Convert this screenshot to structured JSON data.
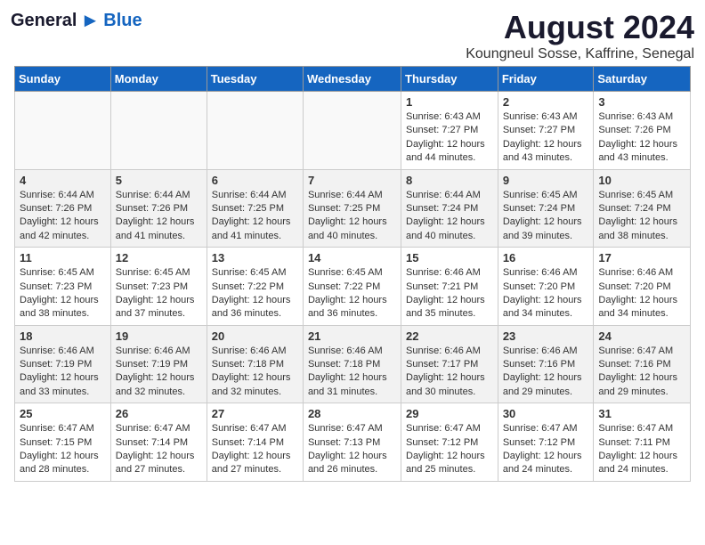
{
  "header": {
    "logo": {
      "general": "General",
      "blue": "Blue"
    },
    "title": "August 2024",
    "location": "Koungneul Sosse, Kaffrine, Senegal"
  },
  "calendar": {
    "days_of_week": [
      "Sunday",
      "Monday",
      "Tuesday",
      "Wednesday",
      "Thursday",
      "Friday",
      "Saturday"
    ],
    "weeks": [
      [
        {
          "day": "",
          "info": ""
        },
        {
          "day": "",
          "info": ""
        },
        {
          "day": "",
          "info": ""
        },
        {
          "day": "",
          "info": ""
        },
        {
          "day": "1",
          "info": "Sunrise: 6:43 AM\nSunset: 7:27 PM\nDaylight: 12 hours\nand 44 minutes."
        },
        {
          "day": "2",
          "info": "Sunrise: 6:43 AM\nSunset: 7:27 PM\nDaylight: 12 hours\nand 43 minutes."
        },
        {
          "day": "3",
          "info": "Sunrise: 6:43 AM\nSunset: 7:26 PM\nDaylight: 12 hours\nand 43 minutes."
        }
      ],
      [
        {
          "day": "4",
          "info": "Sunrise: 6:44 AM\nSunset: 7:26 PM\nDaylight: 12 hours\nand 42 minutes."
        },
        {
          "day": "5",
          "info": "Sunrise: 6:44 AM\nSunset: 7:26 PM\nDaylight: 12 hours\nand 41 minutes."
        },
        {
          "day": "6",
          "info": "Sunrise: 6:44 AM\nSunset: 7:25 PM\nDaylight: 12 hours\nand 41 minutes."
        },
        {
          "day": "7",
          "info": "Sunrise: 6:44 AM\nSunset: 7:25 PM\nDaylight: 12 hours\nand 40 minutes."
        },
        {
          "day": "8",
          "info": "Sunrise: 6:44 AM\nSunset: 7:24 PM\nDaylight: 12 hours\nand 40 minutes."
        },
        {
          "day": "9",
          "info": "Sunrise: 6:45 AM\nSunset: 7:24 PM\nDaylight: 12 hours\nand 39 minutes."
        },
        {
          "day": "10",
          "info": "Sunrise: 6:45 AM\nSunset: 7:24 PM\nDaylight: 12 hours\nand 38 minutes."
        }
      ],
      [
        {
          "day": "11",
          "info": "Sunrise: 6:45 AM\nSunset: 7:23 PM\nDaylight: 12 hours\nand 38 minutes."
        },
        {
          "day": "12",
          "info": "Sunrise: 6:45 AM\nSunset: 7:23 PM\nDaylight: 12 hours\nand 37 minutes."
        },
        {
          "day": "13",
          "info": "Sunrise: 6:45 AM\nSunset: 7:22 PM\nDaylight: 12 hours\nand 36 minutes."
        },
        {
          "day": "14",
          "info": "Sunrise: 6:45 AM\nSunset: 7:22 PM\nDaylight: 12 hours\nand 36 minutes."
        },
        {
          "day": "15",
          "info": "Sunrise: 6:46 AM\nSunset: 7:21 PM\nDaylight: 12 hours\nand 35 minutes."
        },
        {
          "day": "16",
          "info": "Sunrise: 6:46 AM\nSunset: 7:20 PM\nDaylight: 12 hours\nand 34 minutes."
        },
        {
          "day": "17",
          "info": "Sunrise: 6:46 AM\nSunset: 7:20 PM\nDaylight: 12 hours\nand 34 minutes."
        }
      ],
      [
        {
          "day": "18",
          "info": "Sunrise: 6:46 AM\nSunset: 7:19 PM\nDaylight: 12 hours\nand 33 minutes."
        },
        {
          "day": "19",
          "info": "Sunrise: 6:46 AM\nSunset: 7:19 PM\nDaylight: 12 hours\nand 32 minutes."
        },
        {
          "day": "20",
          "info": "Sunrise: 6:46 AM\nSunset: 7:18 PM\nDaylight: 12 hours\nand 32 minutes."
        },
        {
          "day": "21",
          "info": "Sunrise: 6:46 AM\nSunset: 7:18 PM\nDaylight: 12 hours\nand 31 minutes."
        },
        {
          "day": "22",
          "info": "Sunrise: 6:46 AM\nSunset: 7:17 PM\nDaylight: 12 hours\nand 30 minutes."
        },
        {
          "day": "23",
          "info": "Sunrise: 6:46 AM\nSunset: 7:16 PM\nDaylight: 12 hours\nand 29 minutes."
        },
        {
          "day": "24",
          "info": "Sunrise: 6:47 AM\nSunset: 7:16 PM\nDaylight: 12 hours\nand 29 minutes."
        }
      ],
      [
        {
          "day": "25",
          "info": "Sunrise: 6:47 AM\nSunset: 7:15 PM\nDaylight: 12 hours\nand 28 minutes."
        },
        {
          "day": "26",
          "info": "Sunrise: 6:47 AM\nSunset: 7:14 PM\nDaylight: 12 hours\nand 27 minutes."
        },
        {
          "day": "27",
          "info": "Sunrise: 6:47 AM\nSunset: 7:14 PM\nDaylight: 12 hours\nand 27 minutes."
        },
        {
          "day": "28",
          "info": "Sunrise: 6:47 AM\nSunset: 7:13 PM\nDaylight: 12 hours\nand 26 minutes."
        },
        {
          "day": "29",
          "info": "Sunrise: 6:47 AM\nSunset: 7:12 PM\nDaylight: 12 hours\nand 25 minutes."
        },
        {
          "day": "30",
          "info": "Sunrise: 6:47 AM\nSunset: 7:12 PM\nDaylight: 12 hours\nand 24 minutes."
        },
        {
          "day": "31",
          "info": "Sunrise: 6:47 AM\nSunset: 7:11 PM\nDaylight: 12 hours\nand 24 minutes."
        }
      ]
    ]
  }
}
